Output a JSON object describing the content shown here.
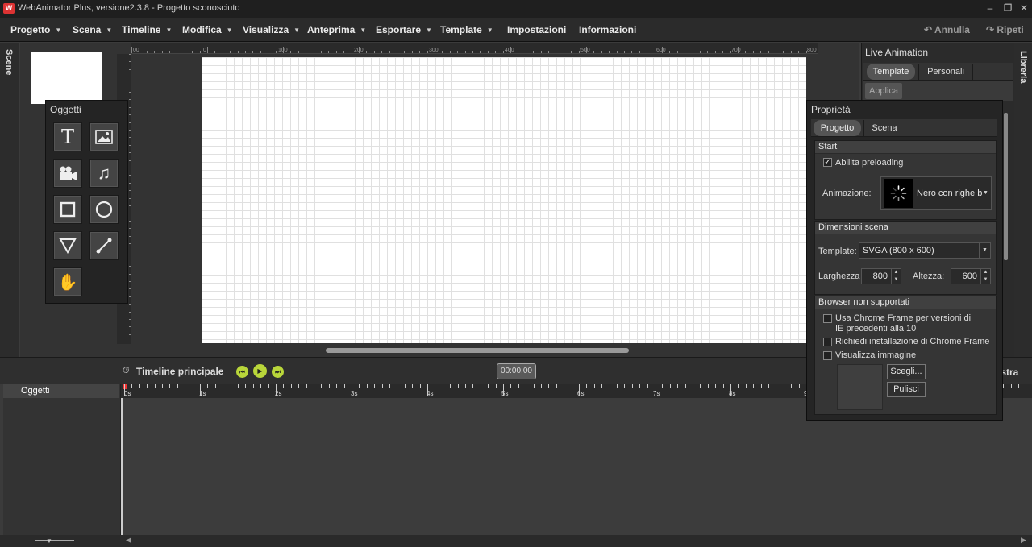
{
  "window": {
    "title": "WebAnimator Plus, versione2.3.8 - Progetto sconosciuto",
    "logo": "W"
  },
  "menu": {
    "items": [
      "Progetto",
      "Scena",
      "Timeline",
      "Modifica",
      "Visualizza",
      "Anteprima",
      "Esportare",
      "Template",
      "Impostazioni",
      "Informazioni"
    ],
    "undo": "Annulla",
    "redo": "Ripeti"
  },
  "side": {
    "scene": "Scene",
    "library": "Libreria"
  },
  "ruler": {
    "labels": [
      "00",
      "0",
      "100",
      "200",
      "300",
      "400",
      "500",
      "600",
      "700",
      "800"
    ]
  },
  "objects": {
    "title": "Oggetti",
    "tools": [
      "text-tool-icon",
      "image-tool-icon",
      "video-tool-icon",
      "audio-tool-icon",
      "rectangle-tool-icon",
      "circle-tool-icon",
      "triangle-tool-icon",
      "line-tool-icon",
      "hand-tool-icon"
    ]
  },
  "live": {
    "title": "Live Animation",
    "tabs": [
      "Template",
      "Personali"
    ],
    "apply": "Applica"
  },
  "props": {
    "title": "Proprietà",
    "tabs": [
      "Progetto",
      "Scena"
    ],
    "start": {
      "header": "Start",
      "preloading_label": "Abilita preloading",
      "preloading_checked": true,
      "animation_label": "Animazione:",
      "animation_value": "Nero con righe b"
    },
    "dimensions": {
      "header": "Dimensioni scena",
      "template_label": "Template:",
      "template_value": "SVGA (800 x 600)",
      "width_label": "Larghezza",
      "width_value": "800",
      "height_label": "Altezza:",
      "height_value": "600"
    },
    "browser": {
      "header": "Browser non supportati",
      "opt1": "Usa Chrome Frame per versioni di IE precedenti alla 10",
      "opt2": "Richiedi installazione di Chrome Frame",
      "opt3": "Visualizza immagine",
      "choose": "Scegli...",
      "clear": "Pulisci"
    }
  },
  "timeline": {
    "title": "Timeline principale",
    "time": "00:00,00",
    "objects_header": "Oggetti",
    "partial_label": "istra",
    "seconds": [
      "0s",
      "1s",
      "2s",
      "3s",
      "4s",
      "5s",
      "6s",
      "7s",
      "8s",
      "9"
    ]
  }
}
